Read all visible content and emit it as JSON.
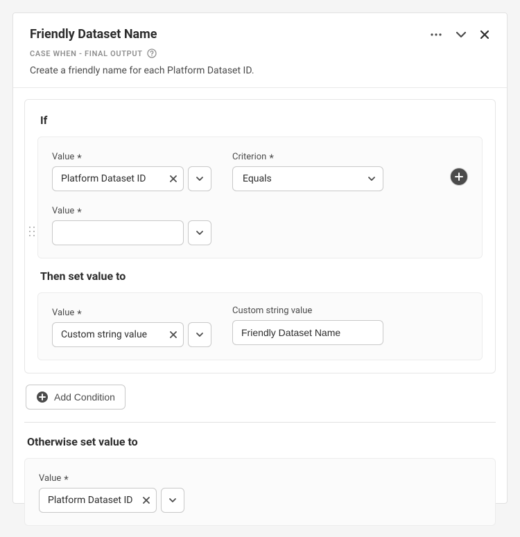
{
  "header": {
    "title": "Friendly Dataset Name",
    "subtitle": "CASE WHEN - FINAL OUTPUT",
    "description": "Create a friendly name for each Platform Dataset ID."
  },
  "condition": {
    "if_label": "If",
    "value1": {
      "label": "Value",
      "required": "*",
      "selected": "Platform Dataset ID"
    },
    "criterion": {
      "label": "Criterion",
      "required": "*",
      "selected": "Equals"
    },
    "value2": {
      "label": "Value",
      "required": "*",
      "selected": ""
    },
    "then_label": "Then set value to",
    "then_value": {
      "label": "Value",
      "required": "*",
      "selected": "Custom string value"
    },
    "custom_string": {
      "label": "Custom string value",
      "value": "Friendly Dataset Name"
    }
  },
  "add_condition_label": "Add Condition",
  "otherwise": {
    "label": "Otherwise set value to",
    "value": {
      "label": "Value",
      "required": "*",
      "selected": "Platform Dataset ID"
    }
  }
}
